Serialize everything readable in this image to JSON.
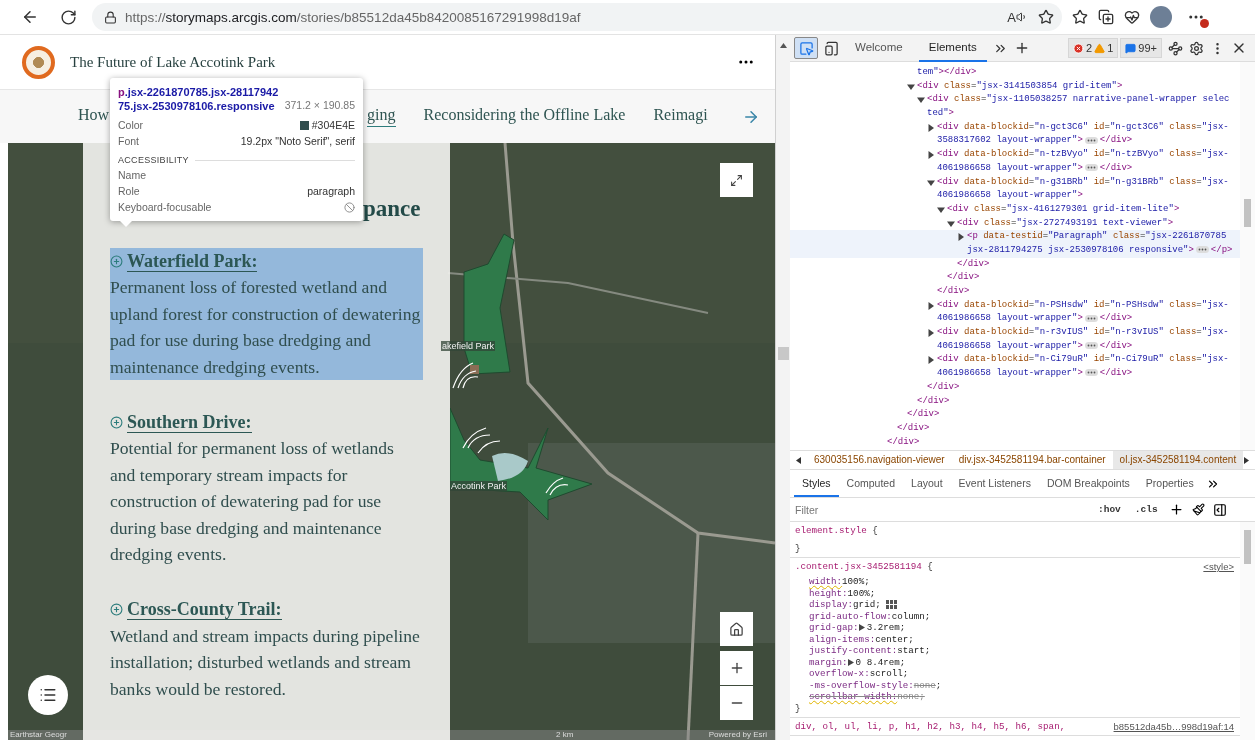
{
  "browser": {
    "url": {
      "scheme": "https://",
      "host": "storymaps.arcgis.com",
      "path": "/stories/b85512da45b8420085167291998d19af"
    },
    "read_aloud": "A"
  },
  "story": {
    "title": "The Future of Lake Accotink Park",
    "nav": [
      {
        "label": "How",
        "selected": false
      },
      {
        "label": "ging",
        "selected": true
      },
      {
        "label": "Reconsidering the Offline Lake",
        "selected": false
      },
      {
        "label": "Reimagi",
        "selected": false
      }
    ],
    "heading": "pance",
    "sections": [
      {
        "title": "Waterfield Park:",
        "text": "Permanent loss of forested wetland and upland forest for construction of dewatering pad for use during base dredging and maintenance dredging events.",
        "selected": true
      },
      {
        "title": "Southern Drive:",
        "text": "Potential for permanent loss of wetlands and temporary stream impacts for construction of dewatering pad for use during base dredging and maintenance dredging events.",
        "selected": false
      },
      {
        "title": "Cross-County Trail:",
        "text": "Wetland and stream impacts during pipeline installation; disturbed wetlands and stream banks would be restored.",
        "selected": false
      }
    ],
    "map": {
      "labels": [
        "akefield Park",
        "Accotink Park"
      ],
      "scale": "2 km",
      "attribution": "Earthstar Geogr",
      "powered_by": "Powered by Esri"
    }
  },
  "tooltip": {
    "selector_tag": "p",
    "selector_rest": ".jsx-2261870785.jsx-2811794275.jsx-2530978106.responsive",
    "size": "371.2 × 190.85",
    "rows": [
      {
        "label": "Color",
        "value": "#304E4E",
        "kind": "color"
      },
      {
        "label": "Font",
        "value": "19.2px \"Noto Serif\", serif",
        "kind": "text"
      }
    ],
    "section": "ACCESSIBILITY",
    "a11y": [
      {
        "label": "Name",
        "kind": "empty"
      },
      {
        "label": "Role",
        "value": "paragraph",
        "kind": "text"
      },
      {
        "label": "Keyboard-focusable",
        "kind": "blocked"
      }
    ]
  },
  "devtools": {
    "inspect_active": true,
    "tabs": [
      {
        "label": "Welcome",
        "selected": false
      },
      {
        "label": "Elements",
        "selected": true
      }
    ],
    "errors": "2",
    "warnings": "1",
    "messages": "99+",
    "dom": [
      {
        "selected": false,
        "close": "</div>",
        "children": [
          {
            "selected": false,
            "close": "</div>",
            "children": [
              {
                "selected": false,
                "close": "</div>",
                "children": [
                  {
                    "lines": [
                      "tem\"></div>"
                    ],
                    "selected": false
                  },
                  {
                    "lines": [
                      "<div class=\"jsx-3141503854 grid-item\">"
                    ],
                    "expanded": true,
                    "selected": false,
                    "close": "</div>",
                    "children": [
                      {
                        "lines": [
                          "<div class=\"jsx-1105038257 narrative-panel-wrapper selec",
                          "ted\">"
                        ],
                        "expanded": true,
                        "selected": false,
                        "close": "</div>",
                        "children": [
                          {
                            "lines": [
                              "<div data-blockid=\"n-gct3C6\" id=\"n-gct3C6\" class=\"jsx-",
                              "3588317602 layout-wrapper\">"
                            ],
                            "expanded": false,
                            "tail": "</div>",
                            "selected": false
                          },
                          {
                            "lines": [
                              "<div data-blockid=\"n-tzBVyo\" id=\"n-tzBVyo\" class=\"jsx-",
                              "4061986658 layout-wrapper\">"
                            ],
                            "expanded": false,
                            "tail": "</div>",
                            "selected": false
                          },
                          {
                            "lines": [
                              "<div data-blockid=\"n-g31BRb\" id=\"n-g31BRb\" class=\"jsx-",
                              "4061986658 layout-wrapper\">"
                            ],
                            "expanded": true,
                            "selected": false,
                            "close": "</div>",
                            "children": [
                              {
                                "lines": [
                                  "<div class=\"jsx-4161279301 grid-item-lite\">"
                                ],
                                "expanded": true,
                                "selected": false,
                                "close": "</div>",
                                "children": [
                                  {
                                    "lines": [
                                      "<div class=\"jsx-2727493191 text-viewer\">"
                                    ],
                                    "expanded": true,
                                    "selected": false,
                                    "close": "</div>",
                                    "children": [
                                      {
                                        "lines": [
                                          "<p data-testid=\"Paragraph\" class=\"jsx-2261870785",
                                          "jsx-2811794275 jsx-2530978106 responsive\">"
                                        ],
                                        "expanded": false,
                                        "tail": "</p>",
                                        "selected": true
                                      }
                                    ]
                                  }
                                ]
                              }
                            ]
                          },
                          {
                            "lines": [
                              "<div data-blockid=\"n-PSHsdw\" id=\"n-PSHsdw\" class=\"jsx-",
                              "4061986658 layout-wrapper\">"
                            ],
                            "expanded": false,
                            "tail": "</div>",
                            "selected": false
                          },
                          {
                            "lines": [
                              "<div data-blockid=\"n-r3vIUS\" id=\"n-r3vIUS\" class=\"jsx-",
                              "4061986658 layout-wrapper\">"
                            ],
                            "expanded": false,
                            "tail": "</div>",
                            "selected": false
                          },
                          {
                            "lines": [
                              "<div data-blockid=\"n-Ci79uR\" id=\"n-Ci79uR\" class=\"jsx-",
                              "4061986658 layout-wrapper\">"
                            ],
                            "expanded": false,
                            "tail": "</div>",
                            "selected": false
                          }
                        ]
                      }
                    ]
                  }
                ]
              }
            ]
          }
        ]
      }
    ],
    "breadcrumbs": [
      {
        "label": "630035156.navigation-viewer",
        "selected": false
      },
      {
        "label": "div.jsx-3452581194.bar-container",
        "selected": false
      },
      {
        "label": "ol.jsx-3452581194.content",
        "selected": true
      }
    ],
    "style_tabs": [
      {
        "label": "Styles",
        "selected": true
      },
      {
        "label": "Computed",
        "selected": false
      },
      {
        "label": "Layout",
        "selected": false
      },
      {
        "label": "Event Listeners",
        "selected": false
      },
      {
        "label": "DOM Breakpoints",
        "selected": false
      },
      {
        "label": "Properties",
        "selected": false
      }
    ],
    "filter": {
      "placeholder": "Filter"
    },
    "hov": ":hov",
    "cls": ".cls",
    "rules": [
      {
        "selector": "element.style",
        "open": "{",
        "close": "}"
      },
      {
        "selector": ".content.jsx-3452581194",
        "open": "{",
        "close": "}",
        "source": "<style>",
        "declarations": [
          {
            "prop": "width:",
            "value": "100%",
            "end": ";",
            "warning": true,
            "value_struck": false,
            "all_struck": false,
            "expandable": false,
            "grid_icon": false
          },
          {
            "prop": "height:",
            "value": "100%",
            "end": ";",
            "warning": false,
            "value_struck": false,
            "all_struck": false,
            "expandable": false,
            "grid_icon": false
          },
          {
            "prop": "display:",
            "value": "grid",
            "end": ";",
            "warning": false,
            "value_struck": false,
            "all_struck": false,
            "expandable": false,
            "grid_icon": true
          },
          {
            "prop": "grid-auto-flow:",
            "value": "column",
            "end": ";",
            "warning": false,
            "value_struck": false,
            "all_struck": false,
            "expandable": false,
            "grid_icon": false
          },
          {
            "prop": "grid-gap:",
            "value": "3.2rem",
            "end": ";",
            "warning": false,
            "value_struck": false,
            "all_struck": false,
            "expandable": true,
            "grid_icon": false
          },
          {
            "prop": "align-items:",
            "value": "center",
            "end": ";",
            "warning": false,
            "value_struck": false,
            "all_struck": false,
            "expandable": false,
            "grid_icon": false
          },
          {
            "prop": "justify-content:",
            "value": "start",
            "end": ";",
            "warning": false,
            "value_struck": false,
            "all_struck": false,
            "expandable": false,
            "grid_icon": false
          },
          {
            "prop": "margin:",
            "value": "0 8.4rem",
            "end": ";",
            "warning": false,
            "value_struck": false,
            "all_struck": false,
            "expandable": true,
            "grid_icon": false
          },
          {
            "prop": "overflow-x:",
            "value": "scroll",
            "end": ";",
            "warning": false,
            "value_struck": false,
            "all_struck": false,
            "expandable": false,
            "grid_icon": false
          },
          {
            "prop": "-ms-overflow-style:",
            "value": "none",
            "end": ";",
            "warning": false,
            "value_struck": true,
            "all_struck": false,
            "expandable": false,
            "grid_icon": false
          },
          {
            "prop": "scrollbar-width:",
            "value": "none",
            "end": ";",
            "warning": true,
            "value_struck": true,
            "all_struck": true,
            "expandable": false,
            "grid_icon": false
          }
        ]
      },
      {
        "selector": "div, ol, ul, li, p, h1, h2, h3, h4, h5, h6, span,",
        "source": "b85512da45b…998d19af:14"
      }
    ]
  }
}
